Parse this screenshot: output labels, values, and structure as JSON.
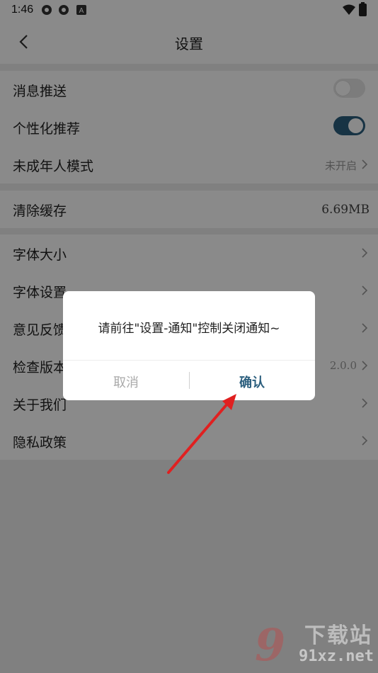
{
  "status_bar": {
    "time": "1:46"
  },
  "header": {
    "title": "设置"
  },
  "group1": [
    {
      "label": "消息推送",
      "toggle": "off"
    },
    {
      "label": "个性化推荐",
      "toggle": "on"
    },
    {
      "label": "未成年人模式",
      "value": "未开启"
    }
  ],
  "group2": [
    {
      "label": "清除缓存",
      "value": "6.69MB"
    }
  ],
  "group3": [
    {
      "label": "字体大小"
    },
    {
      "label": "字体设置"
    },
    {
      "label": "意见反馈"
    },
    {
      "label": "检查版本",
      "value": "2.0.0"
    },
    {
      "label": "关于我们"
    },
    {
      "label": "隐私政策"
    }
  ],
  "dialog": {
    "message": "请前往\"设置-通知\"控制关闭通知~",
    "cancel": "取消",
    "confirm": "确认"
  },
  "watermark": {
    "mark": "9",
    "text": "下载站",
    "url": "91xz.net"
  },
  "colors": {
    "accent": "#2c5f7e",
    "toggle_off": "#e6e6e6",
    "annotation_arrow": "#e02020"
  },
  "icons": {
    "back": "chevron-left-icon",
    "chevron": "chevron-right-icon",
    "wifi": "wifi-icon",
    "battery": "battery-icon"
  }
}
